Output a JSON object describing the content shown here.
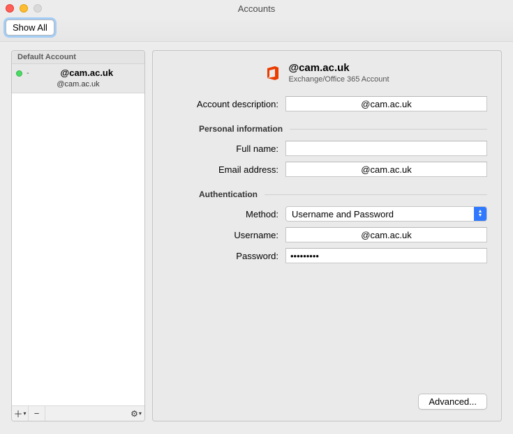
{
  "window": {
    "title": "Accounts"
  },
  "toolbar": {
    "show_all": "Show All"
  },
  "sidebar": {
    "header": "Default Account",
    "item": {
      "name": "@cam.ac.uk",
      "sub": "@cam.ac.uk"
    }
  },
  "account": {
    "title": "@cam.ac.uk",
    "subtitle": "Exchange/Office 365 Account"
  },
  "form": {
    "desc_label": "Account description:",
    "desc_value": "@cam.ac.uk",
    "section_personal": "Personal information",
    "fullname_label": "Full name:",
    "fullname_value": "",
    "email_label": "Email address:",
    "email_value": "@cam.ac.uk",
    "section_auth": "Authentication",
    "method_label": "Method:",
    "method_value": "Username and Password",
    "username_label": "Username:",
    "username_value": "@cam.ac.uk",
    "password_label": "Password:",
    "password_value": "•••••••••"
  },
  "buttons": {
    "advanced": "Advanced..."
  }
}
